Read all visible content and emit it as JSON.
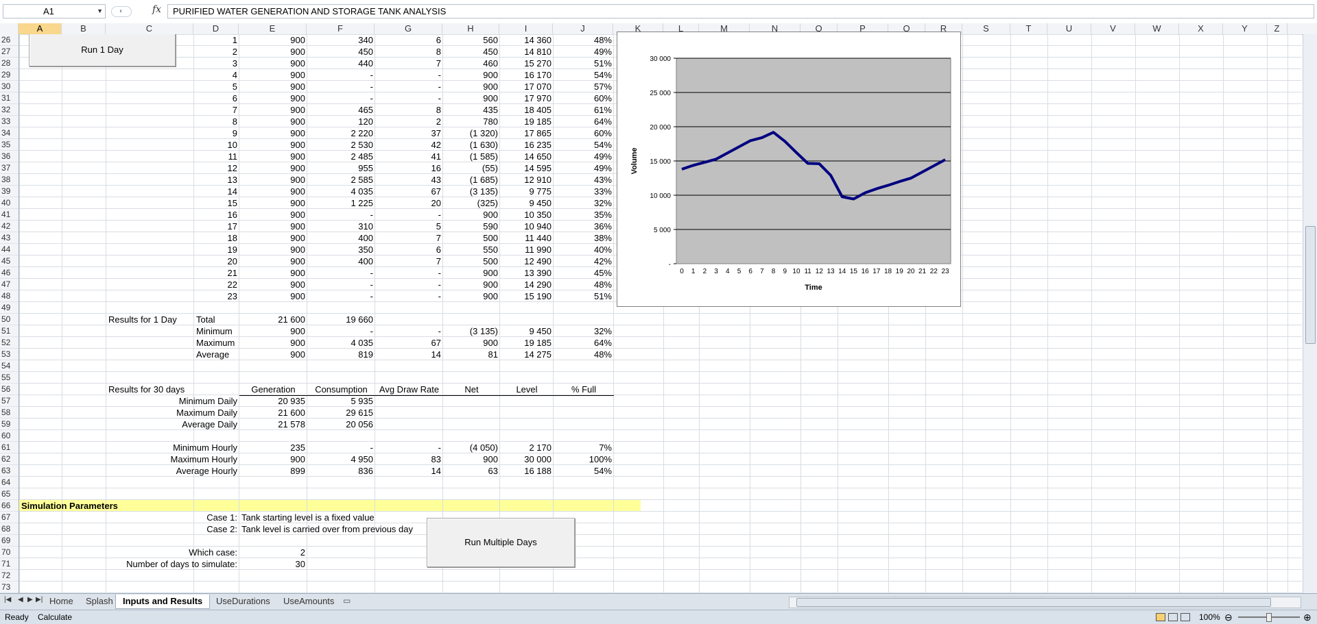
{
  "formula_bar": {
    "cell_ref": "A1",
    "fx": "fx",
    "content": "PURIFIED WATER GENERATION AND STORAGE TANK ANALYSIS"
  },
  "columns": [
    "A",
    "B",
    "C",
    "D",
    "E",
    "F",
    "G",
    "H",
    "I",
    "J",
    "K",
    "L",
    "M",
    "N",
    "O",
    "P",
    "Q",
    "R",
    "S",
    "T",
    "U",
    "V",
    "W",
    "X",
    "Y",
    "Z"
  ],
  "rows": [
    "26",
    "27",
    "28",
    "29",
    "30",
    "31",
    "32",
    "33",
    "34",
    "35",
    "36",
    "37",
    "38",
    "39",
    "40",
    "41",
    "42",
    "43",
    "44",
    "45",
    "46",
    "47",
    "48",
    "49",
    "50",
    "51",
    "52",
    "53",
    "54",
    "55",
    "56",
    "57",
    "58",
    "59",
    "60",
    "61",
    "62",
    "63",
    "64",
    "65",
    "66",
    "67",
    "68",
    "69",
    "70",
    "71",
    "72",
    "73"
  ],
  "hourly": [
    [
      "1",
      "900",
      "340",
      "6",
      "560",
      "14 360",
      "48%"
    ],
    [
      "2",
      "900",
      "450",
      "8",
      "450",
      "14 810",
      "49%"
    ],
    [
      "3",
      "900",
      "440",
      "7",
      "460",
      "15 270",
      "51%"
    ],
    [
      "4",
      "900",
      "-",
      "-",
      "900",
      "16 170",
      "54%"
    ],
    [
      "5",
      "900",
      "-",
      "-",
      "900",
      "17 070",
      "57%"
    ],
    [
      "6",
      "900",
      "-",
      "-",
      "900",
      "17 970",
      "60%"
    ],
    [
      "7",
      "900",
      "465",
      "8",
      "435",
      "18 405",
      "61%"
    ],
    [
      "8",
      "900",
      "120",
      "2",
      "780",
      "19 185",
      "64%"
    ],
    [
      "9",
      "900",
      "2 220",
      "37",
      "(1 320)",
      "17 865",
      "60%"
    ],
    [
      "10",
      "900",
      "2 530",
      "42",
      "(1 630)",
      "16 235",
      "54%"
    ],
    [
      "11",
      "900",
      "2 485",
      "41",
      "(1 585)",
      "14 650",
      "49%"
    ],
    [
      "12",
      "900",
      "955",
      "16",
      "(55)",
      "14 595",
      "49%"
    ],
    [
      "13",
      "900",
      "2 585",
      "43",
      "(1 685)",
      "12 910",
      "43%"
    ],
    [
      "14",
      "900",
      "4 035",
      "67",
      "(3 135)",
      "9 775",
      "33%"
    ],
    [
      "15",
      "900",
      "1 225",
      "20",
      "(325)",
      "9 450",
      "32%"
    ],
    [
      "16",
      "900",
      "-",
      "-",
      "900",
      "10 350",
      "35%"
    ],
    [
      "17",
      "900",
      "310",
      "5",
      "590",
      "10 940",
      "36%"
    ],
    [
      "18",
      "900",
      "400",
      "7",
      "500",
      "11 440",
      "38%"
    ],
    [
      "19",
      "900",
      "350",
      "6",
      "550",
      "11 990",
      "40%"
    ],
    [
      "20",
      "900",
      "400",
      "7",
      "500",
      "12 490",
      "42%"
    ],
    [
      "21",
      "900",
      "-",
      "-",
      "900",
      "13 390",
      "45%"
    ],
    [
      "22",
      "900",
      "-",
      "-",
      "900",
      "14 290",
      "48%"
    ],
    [
      "23",
      "900",
      "-",
      "-",
      "900",
      "15 190",
      "51%"
    ]
  ],
  "results_1day": {
    "title": "Results for 1 Day",
    "rows": [
      [
        "Total",
        "21 600",
        "19 660",
        "",
        "",
        "",
        ""
      ],
      [
        "Minimum",
        "900",
        "-",
        "-",
        "(3 135)",
        "9 450",
        "32%"
      ],
      [
        "Maximum",
        "900",
        "4 035",
        "67",
        "900",
        "19 185",
        "64%"
      ],
      [
        "Average",
        "900",
        "819",
        "14",
        "81",
        "14 275",
        "48%"
      ]
    ]
  },
  "results_30days": {
    "title": "Results for 30 days",
    "headers": [
      "Generation",
      "Consumption",
      "Avg Draw Rate",
      "Net",
      "Level",
      "% Full"
    ],
    "daily": [
      [
        "Minimum Daily",
        "20 935",
        "5 935"
      ],
      [
        "Maximum Daily",
        "21 600",
        "29 615"
      ],
      [
        "Average Daily",
        "21 578",
        "20 056"
      ]
    ],
    "hourly": [
      [
        "Minimum Hourly",
        "235",
        "-",
        "-",
        "(4 050)",
        "2 170",
        "7%"
      ],
      [
        "Maximum Hourly",
        "900",
        "4 950",
        "83",
        "900",
        "30 000",
        "100%"
      ],
      [
        "Average Hourly",
        "899",
        "836",
        "14",
        "63",
        "16 188",
        "54%"
      ]
    ]
  },
  "sim_params": {
    "title": "Simulation Parameters",
    "case1_label": "Case 1:",
    "case1_text": "Tank starting level is a fixed value",
    "case2_label": "Case 2:",
    "case2_text": "Tank level is carried over from previous day",
    "which_case_label": "Which case:",
    "which_case_value": "2",
    "days_label": "Number of days to simulate:",
    "days_value": "30"
  },
  "buttons": {
    "run_1_day": "Run 1 Day",
    "run_multiple": "Run Multiple Days"
  },
  "chart_data": {
    "type": "line",
    "title": "",
    "xlabel": "Time",
    "ylabel": "Volume",
    "x": [
      0,
      1,
      2,
      3,
      4,
      5,
      6,
      7,
      8,
      9,
      10,
      11,
      12,
      13,
      14,
      15,
      16,
      17,
      18,
      19,
      20,
      21,
      22,
      23
    ],
    "series": [
      {
        "values": [
          13800,
          14360,
          14810,
          15270,
          16170,
          17070,
          17970,
          18405,
          19185,
          17865,
          16235,
          14650,
          14595,
          12910,
          9775,
          9450,
          10350,
          10940,
          11440,
          11990,
          12490,
          13390,
          14290,
          15190
        ],
        "color": "#000080"
      }
    ],
    "ylim": [
      0,
      30000
    ],
    "yticks": [
      "-",
      "5 000",
      "10 000",
      "15 000",
      "20 000",
      "25 000",
      "30 000"
    ],
    "plot_bg": "#c0c0c0",
    "grid": true
  },
  "sheet_tabs": [
    "Home",
    "Splash",
    "Inputs and Results",
    "UseDurations",
    "UseAmounts"
  ],
  "active_tab": "Inputs and Results",
  "status": {
    "left1": "Ready",
    "left2": "Calculate",
    "zoom": "100%"
  }
}
